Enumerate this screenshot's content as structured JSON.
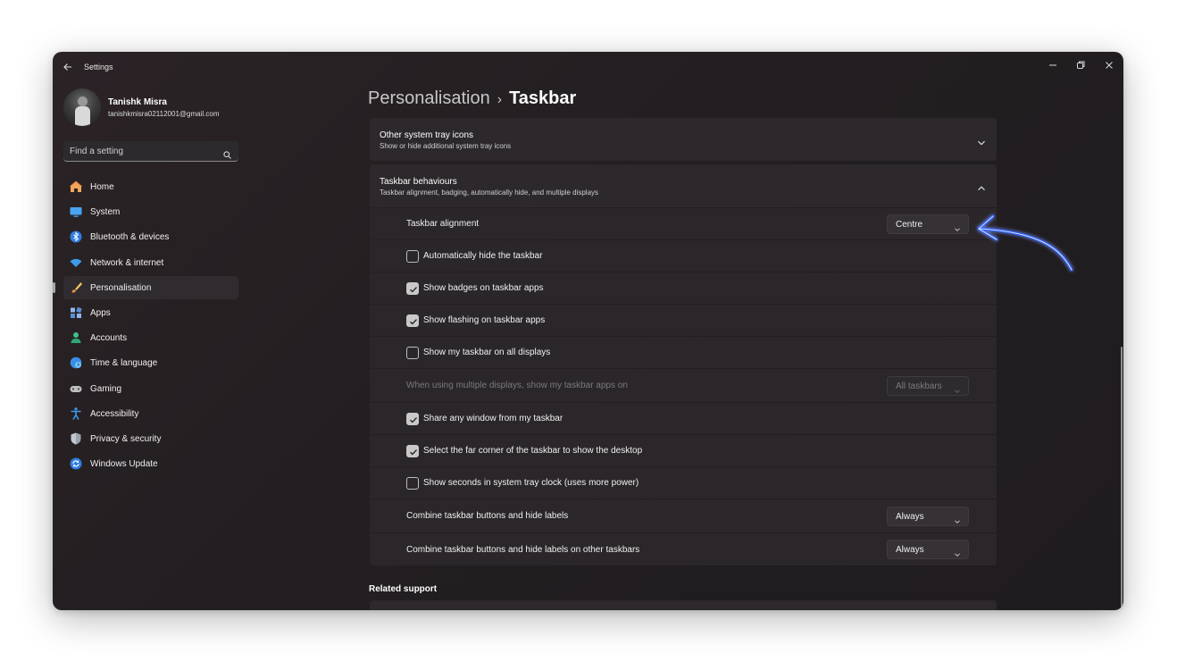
{
  "window": {
    "title": "Settings",
    "controls": [
      "minimize-icon",
      "restore-icon",
      "close-icon"
    ]
  },
  "profile": {
    "name": "Tanishk Misra",
    "email": "tanishkmisra02112001@gmail.com"
  },
  "search": {
    "placeholder": "Find a setting"
  },
  "sidebar": {
    "items": [
      {
        "label": "Home",
        "icon": "home-icon"
      },
      {
        "label": "System",
        "icon": "monitor-icon"
      },
      {
        "label": "Bluetooth & devices",
        "icon": "bluetooth-icon"
      },
      {
        "label": "Network & internet",
        "icon": "wifi-icon"
      },
      {
        "label": "Personalisation",
        "icon": "brush-icon",
        "active": true
      },
      {
        "label": "Apps",
        "icon": "apps-icon"
      },
      {
        "label": "Accounts",
        "icon": "person-icon"
      },
      {
        "label": "Time & language",
        "icon": "globe-clock-icon"
      },
      {
        "label": "Gaming",
        "icon": "controller-icon"
      },
      {
        "label": "Accessibility",
        "icon": "accessibility-icon"
      },
      {
        "label": "Privacy & security",
        "icon": "shield-icon"
      },
      {
        "label": "Windows Update",
        "icon": "update-icon"
      }
    ]
  },
  "breadcrumb": {
    "parent": "Personalisation",
    "separator": "›",
    "current": "Taskbar"
  },
  "sections": {
    "tray": {
      "title": "Other system tray icons",
      "subtitle": "Show or hide additional system tray icons",
      "expanded": false
    },
    "behaviours": {
      "title": "Taskbar behaviours",
      "subtitle": "Taskbar alignment, badging, automatically hide, and multiple displays",
      "expanded": true
    }
  },
  "settings": {
    "alignment": {
      "label": "Taskbar alignment",
      "value": "Centre"
    },
    "auto_hide": {
      "label": "Automatically hide the taskbar",
      "checked": false
    },
    "badges": {
      "label": "Show badges on taskbar apps",
      "checked": true
    },
    "flashing": {
      "label": "Show flashing on taskbar apps",
      "checked": true
    },
    "all_displays": {
      "label": "Show my taskbar on all displays",
      "checked": false
    },
    "multi_display": {
      "label": "When using multiple displays, show my taskbar apps on",
      "value": "All taskbars",
      "disabled": true
    },
    "share_window": {
      "label": "Share any window from my taskbar",
      "checked": true
    },
    "far_corner": {
      "label": "Select the far corner of the taskbar to show the desktop",
      "checked": true
    },
    "seconds": {
      "label": "Show seconds in system tray clock (uses more power)",
      "checked": false
    },
    "combine": {
      "label": "Combine taskbar buttons and hide labels",
      "value": "Always"
    },
    "combine_other": {
      "label": "Combine taskbar buttons and hide labels on other taskbars",
      "value": "Always"
    }
  },
  "related": {
    "title": "Related support"
  },
  "annotation": {
    "icon": "hand-drawn-arrow-icon",
    "color": "#3b6fff"
  },
  "colors": {
    "window_bg": "#221e21",
    "card_bg": "#2c282b",
    "nav_active": "#2f2b2f",
    "checkbox_checked": "#c9c9c9"
  }
}
